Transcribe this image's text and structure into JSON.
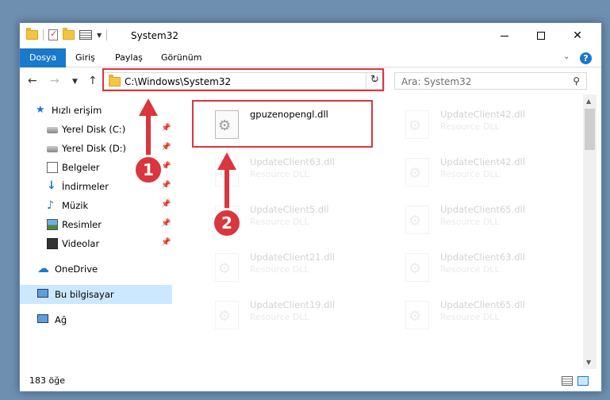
{
  "window": {
    "title": "System32"
  },
  "ribbon": {
    "tabs": [
      {
        "label": "Dosya",
        "active": true
      },
      {
        "label": "Giriş",
        "active": false
      },
      {
        "label": "Paylaş",
        "active": false
      },
      {
        "label": "Görünüm",
        "active": false
      }
    ],
    "help_label": "?"
  },
  "navbar": {
    "address": "C:\\Windows\\System32",
    "search_placeholder": "Ara: System32"
  },
  "sidebar": {
    "items": [
      {
        "label": "Hızlı erişim",
        "icon": "star-icon",
        "pinned": false
      },
      {
        "label": "Yerel Disk (C:)",
        "icon": "disk-icon",
        "pinned": true
      },
      {
        "label": "Yerel Disk (D:)",
        "icon": "disk-icon",
        "pinned": true
      },
      {
        "label": "Belgeler",
        "icon": "documents-icon",
        "pinned": true
      },
      {
        "label": "İndirmeler",
        "icon": "download-icon",
        "pinned": true
      },
      {
        "label": "Müzik",
        "icon": "music-icon",
        "pinned": true
      },
      {
        "label": "Resimler",
        "icon": "pictures-icon",
        "pinned": true
      },
      {
        "label": "Videolar",
        "icon": "videos-icon",
        "pinned": true
      },
      {
        "label": "OneDrive",
        "icon": "cloud-icon",
        "pinned": false
      },
      {
        "label": "Bu bilgisayar",
        "icon": "computer-icon",
        "pinned": false,
        "selected": true
      },
      {
        "label": "Ağ",
        "icon": "network-icon",
        "pinned": false
      }
    ]
  },
  "files": {
    "items": [
      {
        "name": "gpuzenopengl.dll",
        "type": ""
      },
      {
        "name": "UpdateClient42.dll",
        "type": "Resource DLL"
      },
      {
        "name": "UpdateClient63.dll",
        "type": "Resource DLL"
      },
      {
        "name": "UpdateClient42.dll",
        "type": "Resource DLL"
      },
      {
        "name": "UpdateClient5.dll",
        "type": "Resource DLL"
      },
      {
        "name": "UpdateClient65.dll",
        "type": "Resource DLL"
      },
      {
        "name": "UpdateClient21.dll",
        "type": "Resource DLL"
      },
      {
        "name": "UpdateClient63.dll",
        "type": "Resource DLL"
      },
      {
        "name": "UpdateClient19.dll",
        "type": "Resource DLL"
      },
      {
        "name": "UpdateClient65.dll",
        "type": "Resource DLL"
      }
    ]
  },
  "status": {
    "item_count": "183 öğe"
  },
  "annotations": {
    "badge1": "1",
    "badge2": "2"
  },
  "colors": {
    "accent": "#1979ca",
    "annotation": "#d9363e",
    "selection": "#cce8ff"
  }
}
